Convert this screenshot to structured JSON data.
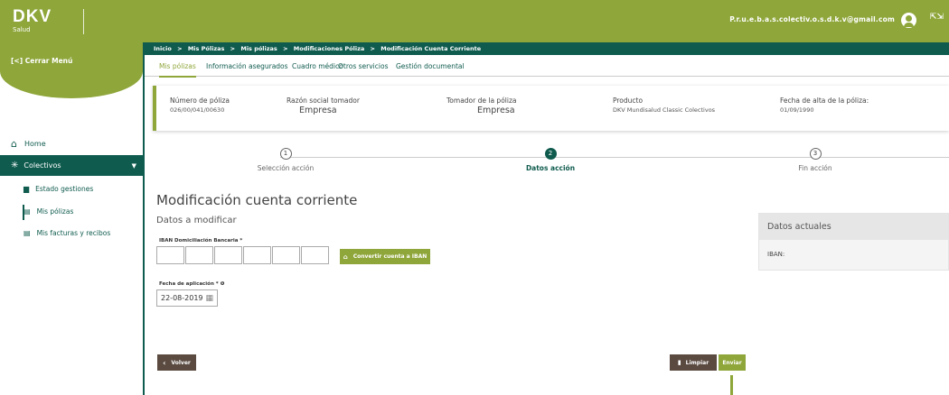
{
  "brand": {
    "name": "DKV",
    "sub": "Salud"
  },
  "header": {
    "user_email": "P.r.u.e.b.a.s.colectiv.o.s.d.k.v@gmail.com",
    "expand_glyph": "⇱⇲"
  },
  "sidebar": {
    "close_menu": "[<] Cerrar Menú",
    "home": "Home",
    "colectivos": "Colectivos",
    "items": [
      {
        "label": "Estado gestiones"
      },
      {
        "label": "Mis pólizas"
      },
      {
        "label": "Mis facturas y recibos"
      }
    ]
  },
  "breadcrumb": [
    "Inicio",
    ">",
    "Mis Pólizas",
    ">",
    "Mis pólizas",
    ">",
    "Modificaciones Póliza",
    ">",
    "Modificación Cuenta Corriente"
  ],
  "tabs": [
    "Mis pólizas",
    "Información asegurados",
    "Cuadro médico",
    "Otros servicios",
    "Gestión documental"
  ],
  "policy": {
    "numero_label": "Número de póliza",
    "numero_value": "026/00/041/00630",
    "razon_label": "Razón social tomador",
    "razon_value": "Empresa",
    "tomador_label": "Tomador de la póliza",
    "tomador_value": "Empresa",
    "producto_label": "Producto",
    "producto_value": "DKV Mundisalud Classic Colectivos",
    "fecha_label": "Fecha de alta de la póliza:",
    "fecha_value": "01/09/1990"
  },
  "steps": [
    {
      "num": "1",
      "label": "Selección acción"
    },
    {
      "num": "2",
      "label": "Datos acción"
    },
    {
      "num": "3",
      "label": "Fin acción"
    }
  ],
  "form": {
    "title": "Modificación cuenta corriente",
    "subtitle": "Datos a modificar",
    "iban_label": "IBAN Domiciliación Bancaria *",
    "convert_button": "Convertir cuenta a IBAN",
    "fecha_label": "Fecha de aplicación * ❶",
    "fecha_value": "22-08-2019"
  },
  "datos_actuales": {
    "title": "Datos actuales",
    "iban_label": "IBAN:"
  },
  "buttons": {
    "volver": "Volver",
    "limpiar": "Limpiar",
    "enviar": "Enviar"
  },
  "colors": {
    "primary_green": "#8ea63a",
    "dark_teal": "#0f5b4e",
    "brown": "#5a4a40"
  }
}
